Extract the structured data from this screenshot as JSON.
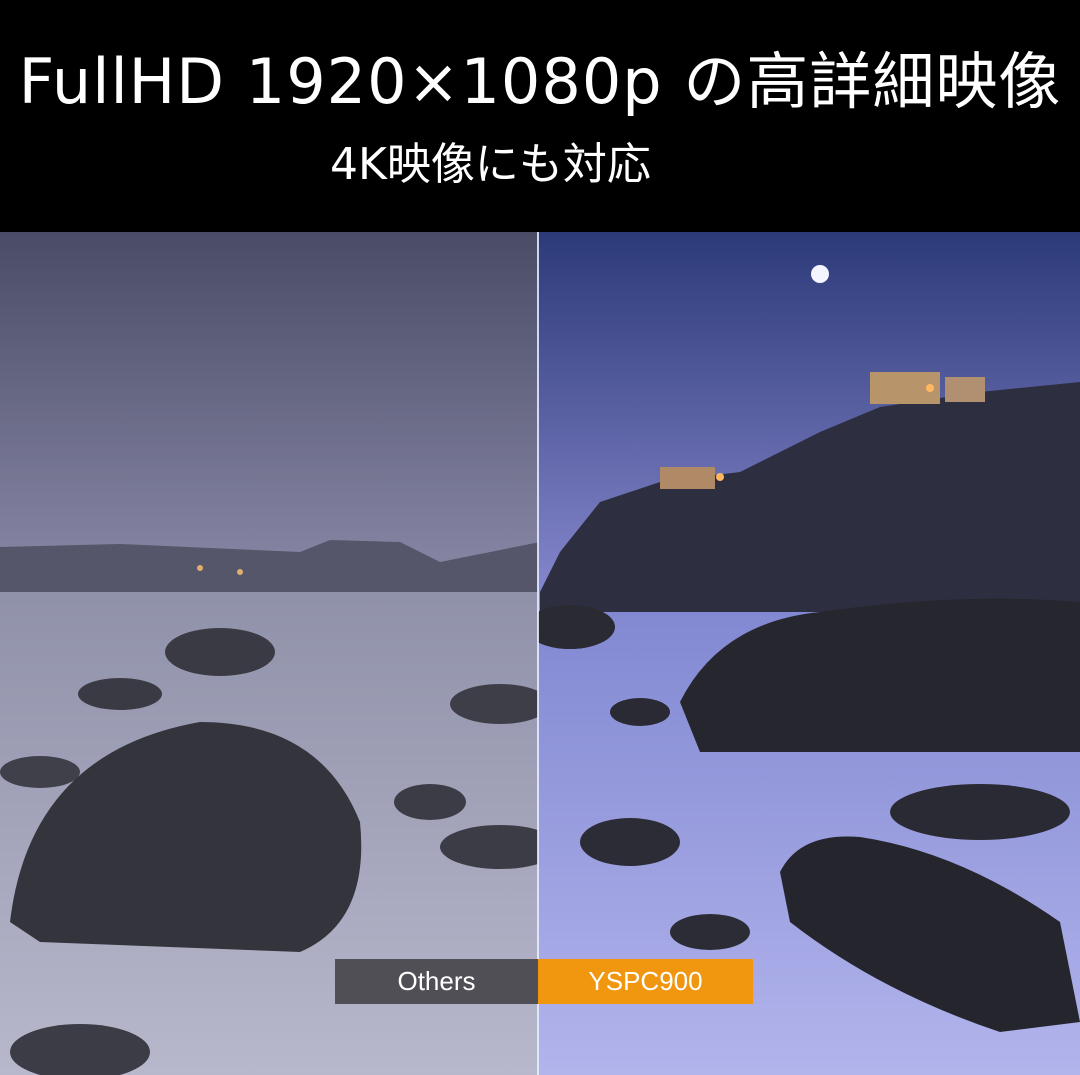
{
  "header": {
    "title": "FullHD 1920×1080p の高詳細映像",
    "subtitle": "4K映像にも対応"
  },
  "comparison": {
    "left_label": "Others",
    "right_label": "YSPC900"
  },
  "colors": {
    "header_bg": "#000000",
    "left_label_bg": "#4f4f55",
    "right_label_bg": "#f0960f"
  }
}
